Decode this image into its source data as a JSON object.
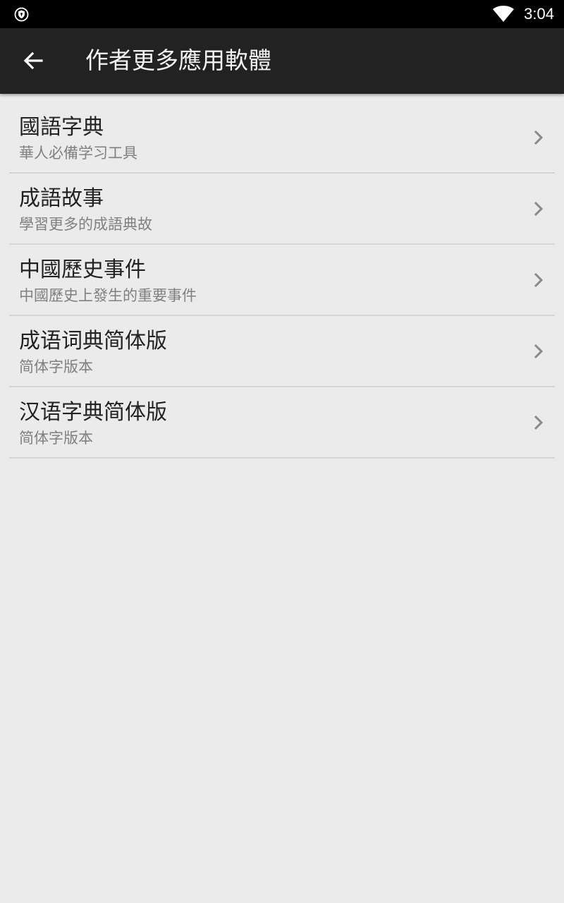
{
  "status_bar": {
    "time": "3:04",
    "left_icon": "shield-icon",
    "right_icon": "wifi-icon"
  },
  "app_bar": {
    "back_icon": "arrow-back-icon",
    "title": "作者更多應用軟體"
  },
  "apps": [
    {
      "title": "國語字典",
      "subtitle": "華人必備学习工具"
    },
    {
      "title": "成語故事",
      "subtitle": "學習更多的成語典故"
    },
    {
      "title": "中國歷史事件",
      "subtitle": "中國歷史上發生的重要事件"
    },
    {
      "title": "成语词典简体版",
      "subtitle": "简体字版本"
    },
    {
      "title": "汉语字典简体版",
      "subtitle": "简体字版本"
    }
  ],
  "colors": {
    "status_bar": "#000000",
    "app_bar": "#222222",
    "background": "#ebebeb",
    "divider": "#d6d6d6",
    "title_text": "#222222",
    "subtitle_text": "#808080"
  }
}
